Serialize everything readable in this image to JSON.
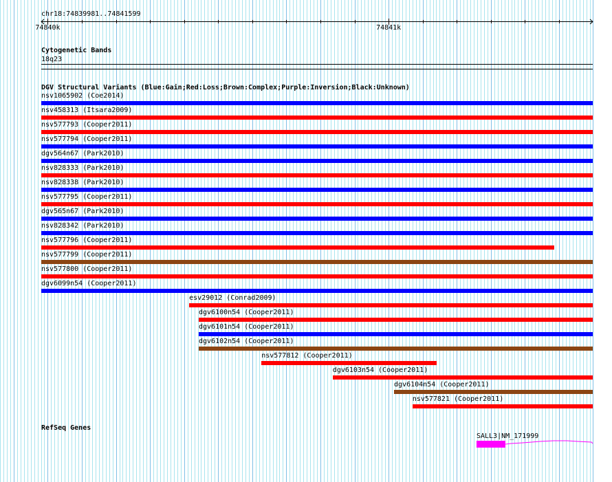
{
  "ruler": {
    "location": "chr18:74839981..74841599",
    "view_start": 74839981,
    "view_end": 74841599,
    "ticks": [
      {
        "pos": 74840000,
        "label": "74840k"
      },
      {
        "pos": 74841000,
        "label": "74841k"
      }
    ]
  },
  "cytoband": {
    "title": "Cytogenetic Bands",
    "band": "18q23"
  },
  "dgv": {
    "title": "DGV Structural Variants (Blue:Gain;Red:Loss;Brown:Complex;Purple:Inversion;Black:Unknown)",
    "colors": {
      "gain": "#0000ff",
      "loss": "#ff0000",
      "complex": "#8b4513"
    },
    "variants": [
      {
        "label": "nsv1065902 (Coe2014)",
        "type": "gain",
        "start": 74839981,
        "end": 74841599
      },
      {
        "label": "nsv458313 (Itsara2009)",
        "type": "loss",
        "start": 74839981,
        "end": 74841599
      },
      {
        "label": "nsv577793 (Cooper2011)",
        "type": "loss",
        "start": 74839981,
        "end": 74841599
      },
      {
        "label": "nsv577794 (Cooper2011)",
        "type": "gain",
        "start": 74839981,
        "end": 74841599
      },
      {
        "label": "dgv564n67 (Park2010)",
        "type": "gain",
        "start": 74839981,
        "end": 74841599
      },
      {
        "label": "nsv828333 (Park2010)",
        "type": "loss",
        "start": 74839981,
        "end": 74841599
      },
      {
        "label": "nsv828338 (Park2010)",
        "type": "gain",
        "start": 74839981,
        "end": 74841599
      },
      {
        "label": "nsv577795 (Cooper2011)",
        "type": "loss",
        "start": 74839981,
        "end": 74841599
      },
      {
        "label": "dgv565n67 (Park2010)",
        "type": "gain",
        "start": 74839981,
        "end": 74841599
      },
      {
        "label": "nsv828342 (Park2010)",
        "type": "gain",
        "start": 74839981,
        "end": 74841599
      },
      {
        "label": "nsv577796 (Cooper2011)",
        "type": "loss",
        "start": 74839981,
        "end": 74841486
      },
      {
        "label": "nsv577799 (Cooper2011)",
        "type": "complex",
        "start": 74839981,
        "end": 74841599
      },
      {
        "label": "nsv577800 (Cooper2011)",
        "type": "loss",
        "start": 74839981,
        "end": 74841599
      },
      {
        "label": "dgv6099n54 (Cooper2011)",
        "type": "gain",
        "start": 74839981,
        "end": 74841599
      },
      {
        "label": "esv29012 (Conrad2009)",
        "type": "loss",
        "start": 74840415,
        "end": 74841599
      },
      {
        "label": "dgv6100n54 (Cooper2011)",
        "type": "loss",
        "start": 74840443,
        "end": 74841599
      },
      {
        "label": "dgv6101n54 (Cooper2011)",
        "type": "gain",
        "start": 74840443,
        "end": 74841599
      },
      {
        "label": "dgv6102n54 (Cooper2011)",
        "type": "complex",
        "start": 74840443,
        "end": 74841599
      },
      {
        "label": "nsv577812 (Cooper2011)",
        "type": "loss",
        "start": 74840627,
        "end": 74841141
      },
      {
        "label": "dgv6103n54 (Cooper2011)",
        "type": "loss",
        "start": 74840836,
        "end": 74841599
      },
      {
        "label": "dgv6104n54 (Cooper2011)",
        "type": "complex",
        "start": 74841016,
        "end": 74841599
      },
      {
        "label": "nsv577821 (Cooper2011)",
        "type": "loss",
        "start": 74841070,
        "end": 74841599
      }
    ]
  },
  "refseq": {
    "title": "RefSeq Genes",
    "gene": {
      "label": "SALL3|NM_171999",
      "color": "#ff00ff",
      "exon_start": 74841258,
      "exon_end": 74841343
    }
  }
}
